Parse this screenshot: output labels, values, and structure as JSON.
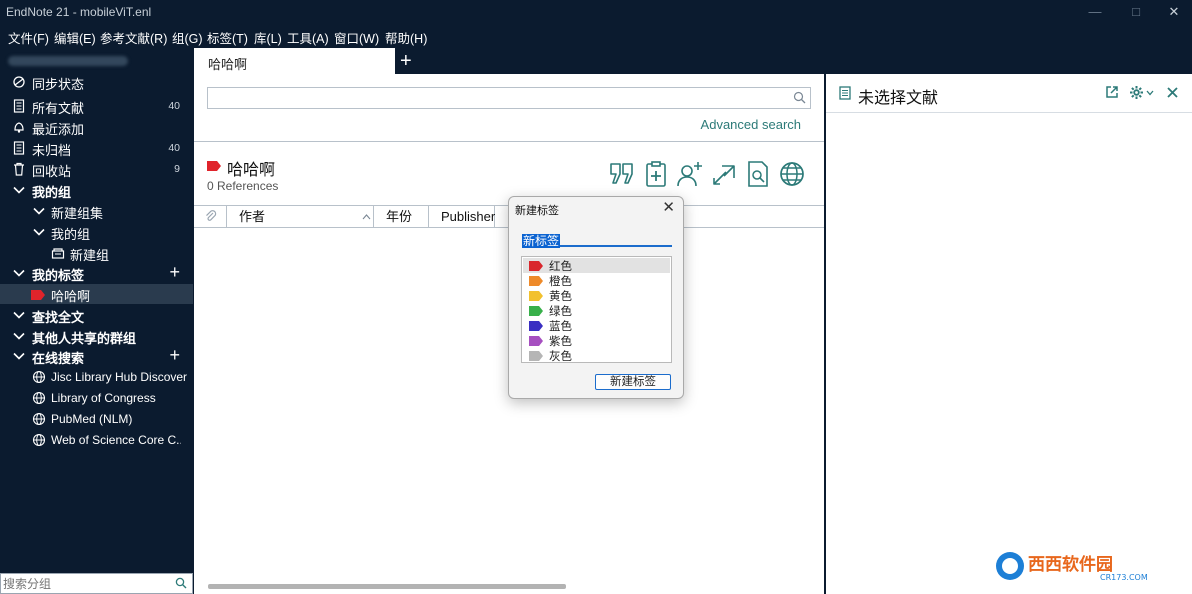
{
  "window": {
    "title": "EndNote 21 - mobileViT.enl"
  },
  "menu": [
    "文件(F)",
    "编辑(E)",
    "参考文献(R)",
    "组(G)",
    "标签(T)",
    "库(L)",
    "工具(A)",
    "窗口(W)",
    "帮助(H)"
  ],
  "sidebar": {
    "sync": "同步状态",
    "all_refs": {
      "label": "所有文献",
      "count": "40"
    },
    "recent": "最近添加",
    "unfiled": {
      "label": "未归档",
      "count": "40"
    },
    "trash": {
      "label": "回收站",
      "count": "9"
    },
    "my_groups": "我的组",
    "new_group_set": "新建组集",
    "my_group": "我的组",
    "new_group": "新建组",
    "my_tags": "我的标签",
    "tag_item": "哈哈啊",
    "find_fulltext": "查找全文",
    "shared_groups": "其他人共享的群组",
    "online_search": "在线搜索",
    "online_items": [
      "Jisc Library Hub Discover",
      "Library of Congress",
      "PubMed (NLM)",
      "Web of Science Core C..."
    ],
    "search_placeholder": "搜索分组",
    "tag_color": "#e0242b"
  },
  "main": {
    "tab_label": "哈哈啊",
    "advanced_search": "Advanced search",
    "group_title": "哈哈啊",
    "ref_count": "0 References",
    "columns": [
      "作者",
      "年份",
      "Publisher"
    ],
    "accent": "#2c7a78"
  },
  "right": {
    "title": "未选择文献"
  },
  "dialog": {
    "title": "新建标签",
    "input_value": "新标签",
    "options": [
      {
        "label": "红色",
        "color": "#d9262c"
      },
      {
        "label": "橙色",
        "color": "#ee8a2a"
      },
      {
        "label": "黄色",
        "color": "#f2c12e"
      },
      {
        "label": "绿色",
        "color": "#38b04a"
      },
      {
        "label": "蓝色",
        "color": "#3a2fc2"
      },
      {
        "label": "紫色",
        "color": "#a64fc0"
      },
      {
        "label": "灰色",
        "color": "#b5b5b5"
      }
    ],
    "button": "新建标签"
  },
  "watermark": {
    "brand": "西西软件园",
    "site": "CR173.COM"
  }
}
